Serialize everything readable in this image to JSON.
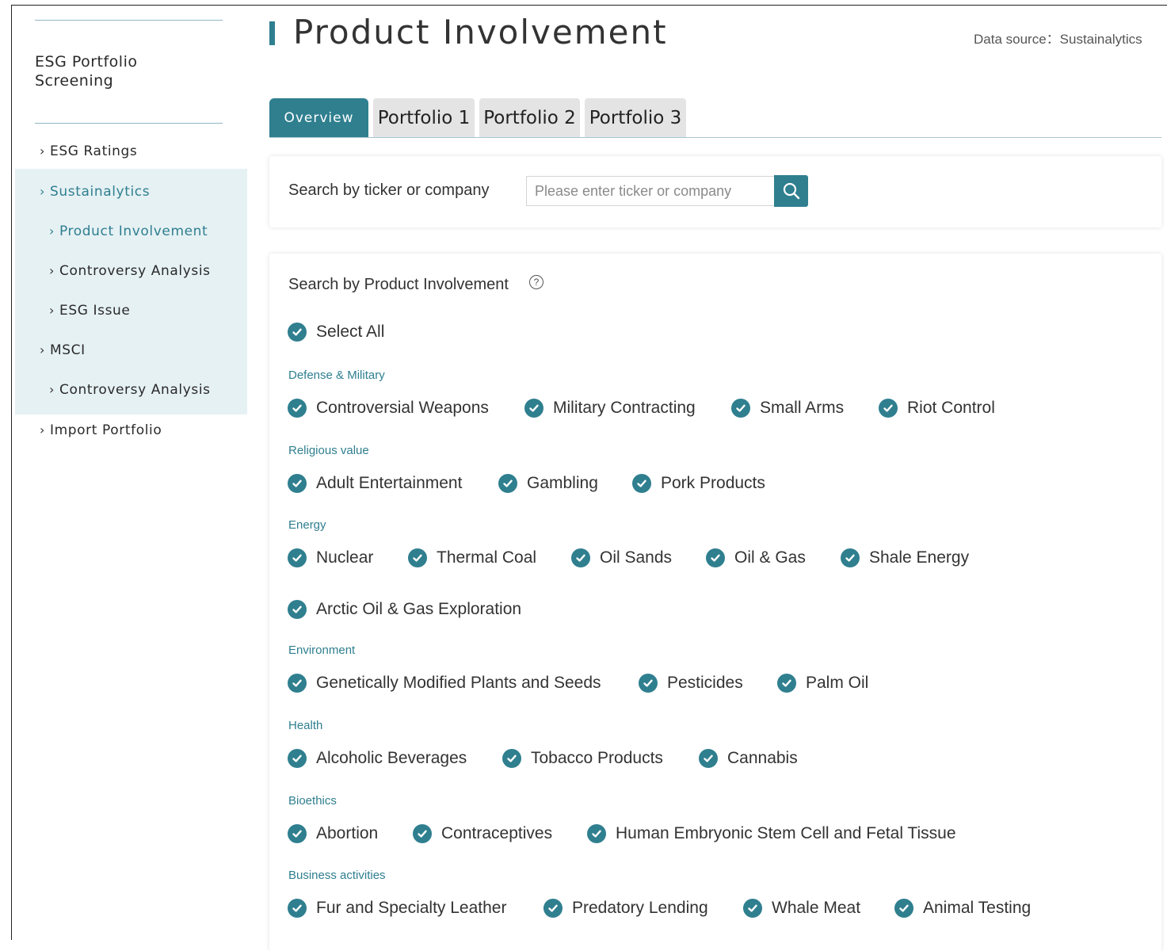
{
  "sidebar": {
    "brand": "ESG Portfolio Screening",
    "items": [
      {
        "label": "ESG Ratings"
      },
      {
        "label": "Sustainalytics"
      },
      {
        "label": "Product Involvement"
      },
      {
        "label": "Controversy Analysis"
      },
      {
        "label": "ESG Issue"
      },
      {
        "label": "MSCI"
      },
      {
        "label": "Controversy Analysis"
      },
      {
        "label": "Import Portfolio"
      }
    ]
  },
  "header": {
    "title": "Product Involvement",
    "datasource": "Data source：Sustainalytics"
  },
  "tabs": [
    "Overview",
    "Portfolio 1",
    "Portfolio 2",
    "Portfolio 3"
  ],
  "search": {
    "label": "Search by ticker or company",
    "placeholder": "Please enter ticker or company",
    "button_icon": "search-icon"
  },
  "involvement": {
    "title": "Search by Product Involvement",
    "help_icon": "?",
    "select_all": "Select All",
    "categories": [
      {
        "name": "Defense & Military",
        "items": [
          "Controversial Weapons",
          "Military Contracting",
          "Small Arms",
          "Riot Control"
        ]
      },
      {
        "name": "Religious value",
        "items": [
          "Adult Entertainment",
          "Gambling",
          "Pork Products"
        ]
      },
      {
        "name": "Energy",
        "items": [
          "Nuclear",
          "Thermal Coal",
          "Oil Sands",
          "Oil & Gas",
          "Shale Energy",
          "Arctic Oil & Gas Exploration"
        ]
      },
      {
        "name": "Environment",
        "items": [
          "Genetically Modified Plants and Seeds",
          "Pesticides",
          "Palm Oil"
        ]
      },
      {
        "name": "Health",
        "items": [
          "Alcoholic Beverages",
          "Tobacco Products",
          "Cannabis"
        ]
      },
      {
        "name": "Bioethics",
        "items": [
          "Abortion",
          "Contraceptives",
          "Human Embryonic Stem Cell and Fetal Tissue"
        ]
      },
      {
        "name": "Business activities",
        "items": [
          "Fur and Specialty Leather",
          "Predatory Lending",
          "Whale Meat",
          "Animal Testing"
        ]
      }
    ]
  },
  "colors": {
    "accent": "#2f7f8f",
    "nav_active_bg": "#e6f1f4",
    "tab_bg": "#e4e4e4"
  }
}
